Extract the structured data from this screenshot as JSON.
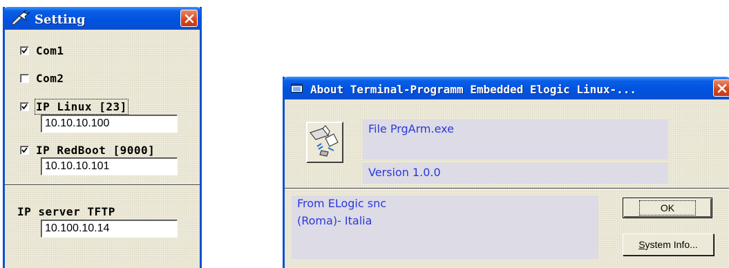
{
  "setting_window": {
    "title": "Setting",
    "checkboxes": [
      {
        "label": "Com1",
        "checked": true
      },
      {
        "label": "Com2",
        "checked": false
      },
      {
        "label": "IP Linux [23]",
        "checked": true
      },
      {
        "label": "IP RedBoot [9000]",
        "checked": true
      }
    ],
    "ip_linux_value": "10.10.10.100",
    "ip_redboot_value": "10.10.10.101",
    "tftp_label": "IP server TFTP",
    "tftp_value": "10.100.10.14"
  },
  "about_window": {
    "title": "About Terminal-Programm Embedded Elogic Linux-...",
    "file_text": "File PrgArm.exe",
    "version_text": "Version 1.0.0",
    "from_line1": "From ELogic snc",
    "from_line2": "(Roma)- Italia",
    "ok_button": "OK",
    "sysinfo_button": "System Info..."
  },
  "colors": {
    "titlebar_blue": "#0a5fe6",
    "close_red": "#d6451e",
    "info_text": "#2b39d8",
    "info_bg": "#dcdbe6"
  },
  "icons": [
    "setting-app-icon",
    "about-app-icon",
    "close-icon",
    "program-icon"
  ]
}
